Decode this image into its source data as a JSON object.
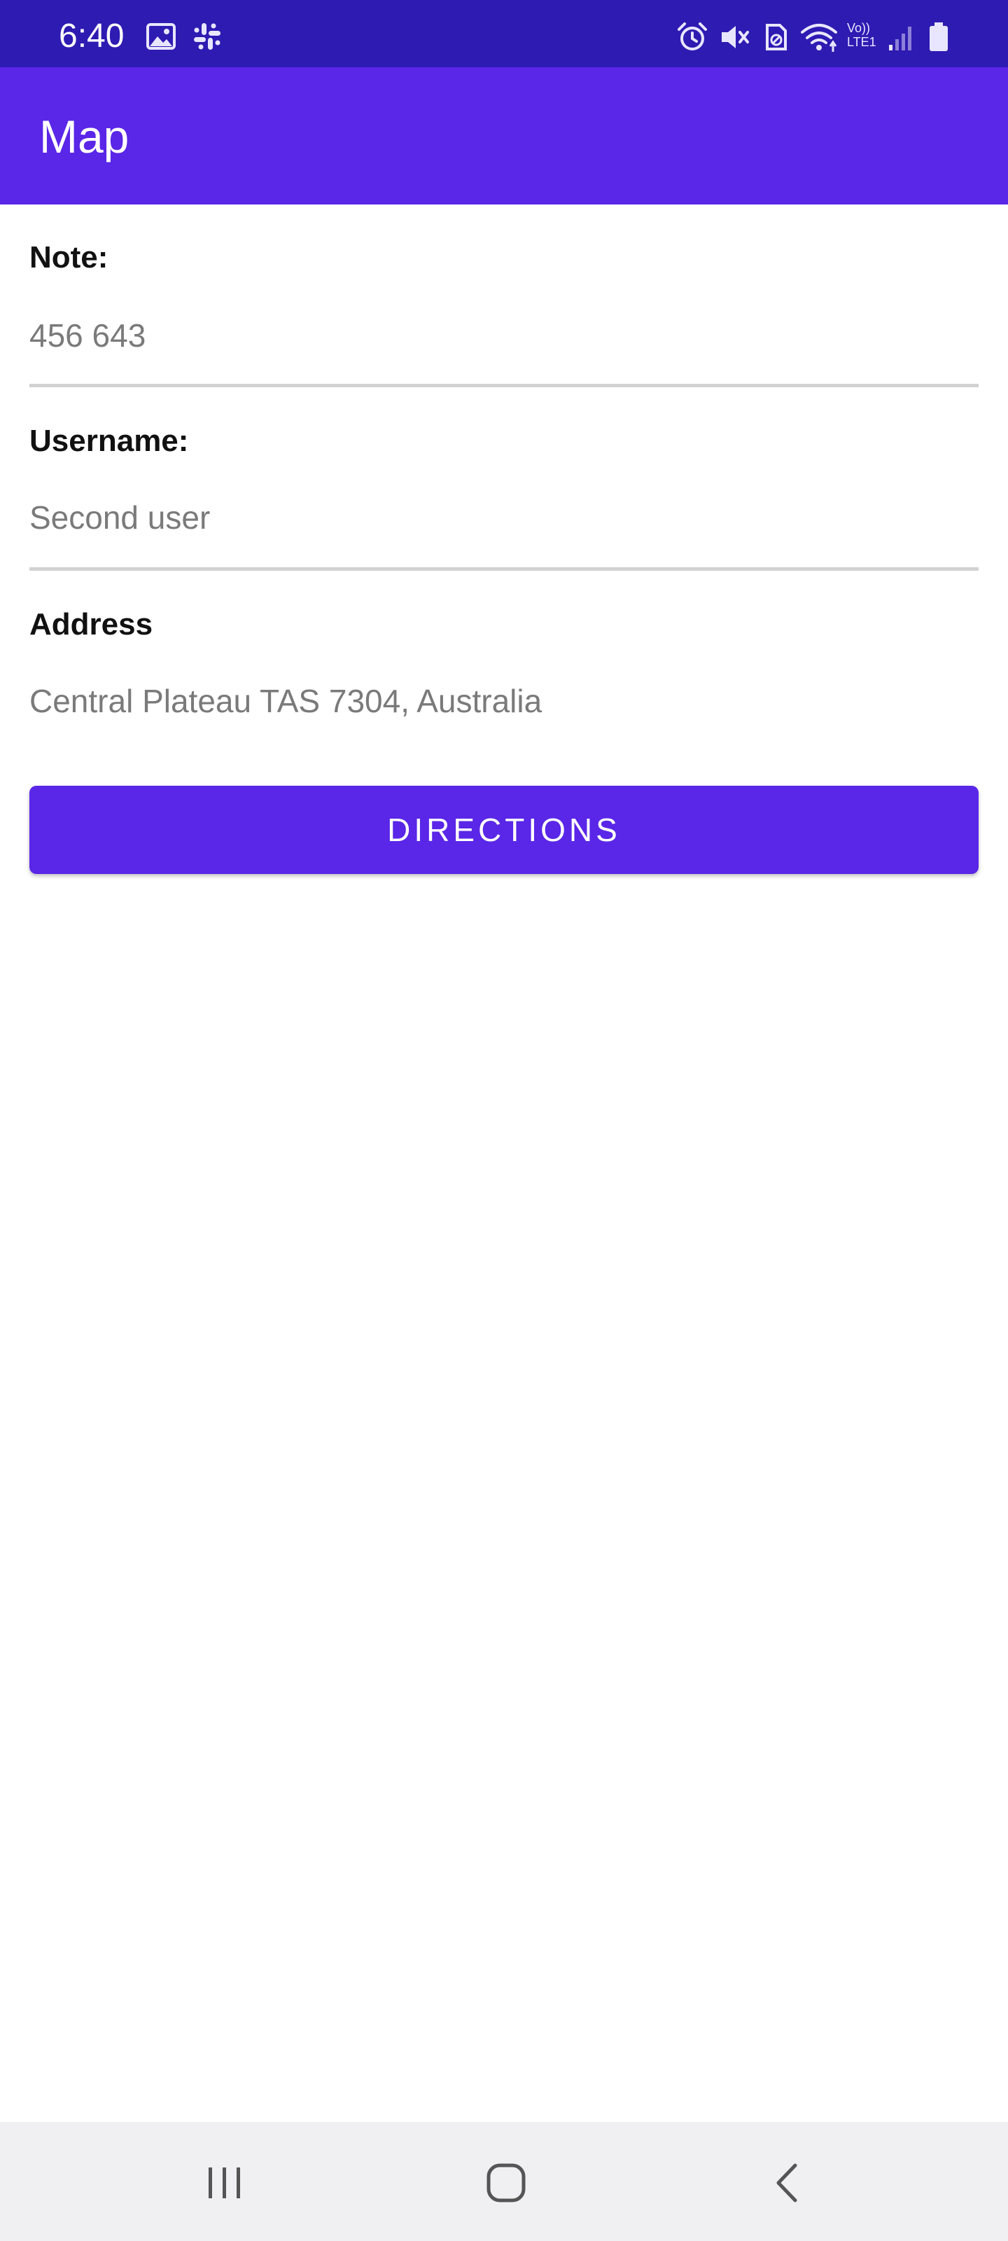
{
  "status_bar": {
    "time": "6:40",
    "left_icons": [
      "image-icon",
      "slack-icon"
    ],
    "right_icons": [
      "alarm-icon",
      "mute-icon",
      "data-saver-icon",
      "wifi-icon",
      "volte-icon",
      "signal-icon",
      "battery-icon"
    ],
    "volte_line1": "Vo))",
    "volte_line2": "LTE1"
  },
  "app_bar": {
    "title": "Map"
  },
  "form": {
    "note_label": "Note:",
    "note_value": "456 643",
    "username_label": "Username:",
    "username_value": "Second user",
    "address_label": "Address",
    "address_value": "Central Plateau TAS 7304, Australia"
  },
  "actions": {
    "directions_label": "DIRECTIONS"
  },
  "nav_bar": {
    "buttons": [
      "recent-apps-icon",
      "home-icon",
      "back-icon"
    ]
  },
  "colors": {
    "status_bar": "#2e1bb2",
    "primary": "#5a26e7",
    "nav_bar": "#f0f0f2"
  }
}
